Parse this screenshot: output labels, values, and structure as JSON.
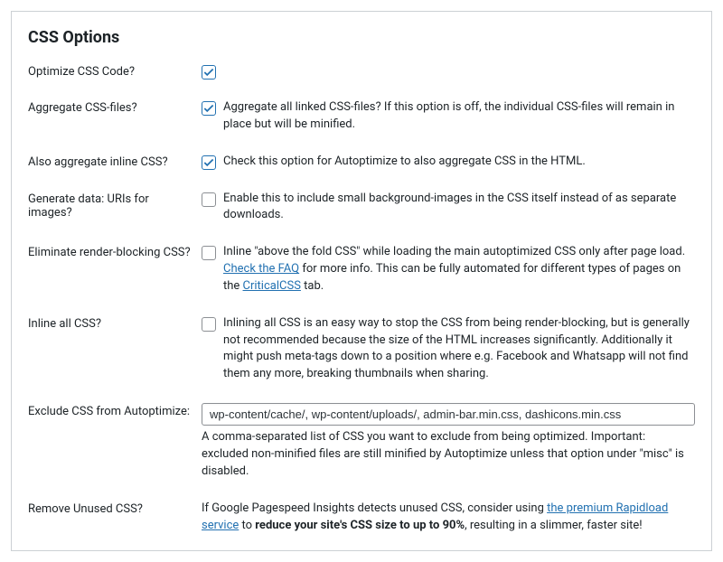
{
  "panel": {
    "title": "CSS Options"
  },
  "optimize": {
    "label": "Optimize CSS Code?",
    "checked": true
  },
  "aggregate": {
    "label": "Aggregate CSS-files?",
    "checked": true,
    "desc": "Aggregate all linked CSS-files? If this option is off, the individual CSS-files will remain in place but will be minified."
  },
  "also_inline": {
    "label": "Also aggregate inline CSS?",
    "checked": true,
    "desc": "Check this option for Autoptimize to also aggregate CSS in the HTML."
  },
  "data_uris": {
    "label": "Generate data: URIs for images?",
    "checked": false,
    "desc": "Enable this to include small background-images in the CSS itself instead of as separate downloads."
  },
  "render_blocking": {
    "label": "Eliminate render-blocking CSS?",
    "checked": false,
    "desc_pre": "Inline \"above the fold CSS\" while loading the main autoptimized CSS only after page load. ",
    "link1": "Check the FAQ",
    "desc_mid": " for more info. This can be fully automated for different types of pages on the ",
    "link2": "CriticalCSS",
    "desc_post": " tab."
  },
  "inline_all": {
    "label": "Inline all CSS?",
    "checked": false,
    "desc": "Inlining all CSS is an easy way to stop the CSS from being render-blocking, but is generally not recommended because the size of the HTML increases significantly. Additionally it might push meta-tags down to a position where e.g. Facebook and Whatsapp will not find them any more, breaking thumbnails when sharing."
  },
  "exclude": {
    "label": "Exclude CSS from Autoptimize:",
    "value": "wp-content/cache/, wp-content/uploads/, admin-bar.min.css, dashicons.min.css",
    "help": "A comma-separated list of CSS you want to exclude from being optimized. Important: excluded non-minified files are still minified by Autoptimize unless that option under \"misc\" is disabled."
  },
  "remove_unused": {
    "label": "Remove Unused CSS?",
    "desc_pre": "If Google Pagespeed Insights detects unused CSS, consider using ",
    "link": "the premium Rapidload service",
    "desc_mid": " to ",
    "bold": "reduce your site's CSS size to up to 90%",
    "desc_post": ", resulting in a slimmer, faster site!"
  }
}
